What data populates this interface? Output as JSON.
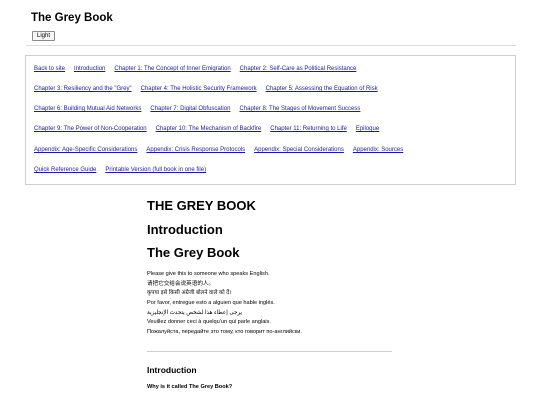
{
  "header": {
    "site_title": "The Grey Book",
    "theme_toggle": "Light"
  },
  "nav": {
    "rows": [
      [
        "Back to site",
        "Introduction",
        "Chapter 1: The Concept of Inner Emigration",
        "Chapter 2: Self-Care as Political Resistance"
      ],
      [
        "Chapter 3: Resiliency and the \"Grey\"",
        "Chapter 4: The Holistic Security Framework",
        "Chapter 5: Assessing the Equation of Risk"
      ],
      [
        "Chapter 6: Building Mutual Aid Networks",
        "Chapter 7: Digital Obfuscation",
        "Chapter 8: The Stages of Movement Success"
      ],
      [
        "Chapter 9: The Power of Non-Cooperation",
        "Chapter 10: The Mechanism of Backfire",
        "Chapter 11: Returning to Life",
        "Epilogue"
      ],
      [
        "Appendix: Age-Specific Considerations",
        "Appendix: Crisis Response Protocols",
        "Appendix: Special Considerations",
        "Appendix: Sources"
      ],
      [
        "Quick Reference Guide",
        "Printable Version (full book in one file)"
      ]
    ]
  },
  "main": {
    "book_title": "THE GREY BOOK",
    "intro_heading": "Introduction",
    "grey_heading": "The Grey Book",
    "language_lines": [
      "Please give this to someone who speaks English.",
      "请把它交给会说英语的人。",
      "कृपया इसे किसी अंग्रेजी बोलने वाले को दें।",
      "Por favor, entregue esto a alguien que hable inglés.",
      "يرجى إعطاء هذا لشخص يتحدث الإنجليزية",
      "Veuillez donner ceci à quelqu'un qui parle anglais.",
      "Пожалуйста, передайте это тому, кто говорит по-английски."
    ],
    "intro_subheading": "Introduction",
    "why_question": "Why is it called The Grey Book?"
  }
}
